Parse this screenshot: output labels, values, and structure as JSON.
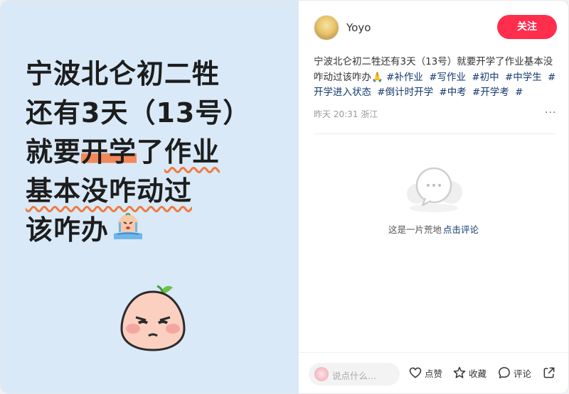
{
  "headline": {
    "line1": "宁波北仑初二牲",
    "line2": "还有3天（13号）",
    "line3_pre": "就要",
    "line3_hl": "开学",
    "line3_mid": "了",
    "line3_wavy": "作业",
    "line4": "基本没咋动过",
    "line5": "该咋办"
  },
  "author": {
    "name": "Yoyo",
    "follow_label": "关注"
  },
  "post": {
    "text": "宁波北仑初二牲还有3天（13号）就要开学了作业基本没咋动过该咋办",
    "emoji": "🙏",
    "tags": [
      "#补作业",
      "#写作业",
      "#初中",
      "#中学生",
      "#开学进入状态",
      "#倒计时开学",
      "#中考",
      "#开学考",
      "#"
    ],
    "meta": "昨天 20:31 浙江",
    "more": "···"
  },
  "comments": {
    "empty_text": "这是一片荒地",
    "empty_link": "点击评论"
  },
  "bottom_bar": {
    "placeholder": "说点什么...",
    "like_label": "点赞",
    "collect_label": "收藏",
    "comment_label": "评论"
  },
  "colors": {
    "accent": "#ff2e4d",
    "tag": "#13386c",
    "panel": "#d9e9f8",
    "highlight": "#f2885a"
  }
}
